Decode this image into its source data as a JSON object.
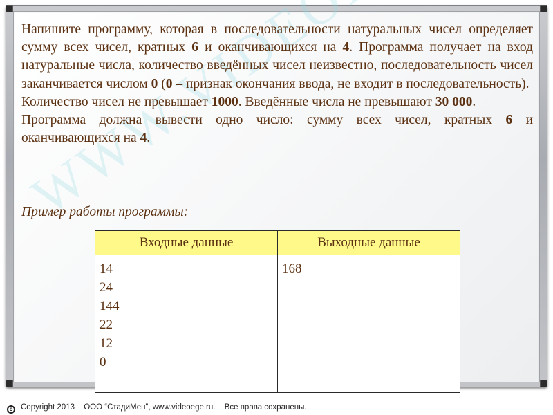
{
  "task": {
    "p1_a": "Напишите программу, которая в последовательности натуральных чисел определяет сумму всех чисел, кратных ",
    "p1_b": "6",
    "p1_c": " и оканчивающихся на ",
    "p1_d": "4",
    "p1_e": ". Программа получает на вход натуральные числа, количество введённых чисел неизвестно, последовательность чисел заканчивается числом ",
    "p1_f": "0",
    "p1_g": " (",
    "p1_h": "0",
    "p1_i": " – признак окончания ввода, не входит в последовательность).",
    "p2_a": "Количество чисел не превышает ",
    "p2_b": "1000",
    "p2_c": ". Введённые числа не превышают ",
    "p2_d": "30 000",
    "p2_e": ".",
    "p3_a": "Программа должна вывести одно число: сумму всех чисел, кратных ",
    "p3_b": "6",
    "p3_c": " и оканчивающихся на ",
    "p3_d": "4",
    "p3_e": "."
  },
  "example_label": "Пример работы программы:",
  "table": {
    "header_input": "Входные данные",
    "header_output": "Выходные данные",
    "input_lines": [
      "14",
      "24",
      "144",
      "22",
      "12",
      "0"
    ],
    "output": "168"
  },
  "watermark": "WWW.VIDEOEGE.RU",
  "footer": {
    "copyright": "Copyright 2013",
    "company": "ООО “СтадиМен”, www.videoege.ru.",
    "rights": "Все права сохранены."
  }
}
